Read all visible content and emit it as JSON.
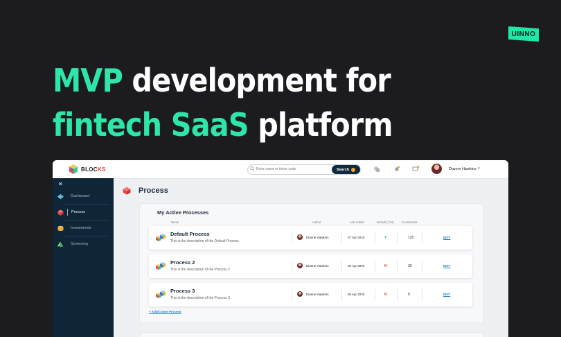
{
  "brand_badge": "UINNO",
  "headline": {
    "line1_accent": "MVP",
    "line1_rest": " development for",
    "line2_accent": "fintech SaaS",
    "line2_rest": " platform"
  },
  "app": {
    "logo_text_a": "BLOC",
    "logo_text_b": "KS",
    "search_placeholder": "Enter name or ticker code",
    "search_button": "Search",
    "user_name": "Dianne Hawkins",
    "sidebar": [
      {
        "label": "Dashboard",
        "icon": "dashboard-icon"
      },
      {
        "label": "Process",
        "icon": "process-cube-icon",
        "active": true
      },
      {
        "label": "Investments",
        "icon": "investments-coin-icon"
      },
      {
        "label": "Screening",
        "icon": "screening-pyramid-icon"
      }
    ],
    "page_title": "Process",
    "panel_title": "My Active Processes",
    "columns": {
      "name": "Name",
      "author": "Author",
      "last_edited": "Last edited",
      "default": "Default (Y/N)",
      "investments": "Investments"
    },
    "rows": [
      {
        "name": "Default Process",
        "description": "This is the description of the Default Process",
        "author": "Dianne Hawkins",
        "date": "07 Apr 2020",
        "default": "Y",
        "investments": "125",
        "edit": "EDIT"
      },
      {
        "name": "Process 2",
        "description": "This is the description of the Process 2",
        "author": "Dianne Hawkins",
        "date": "08 Apr 2020",
        "default": "N",
        "investments": "30",
        "edit": "EDIT"
      },
      {
        "name": "Process 3",
        "description": "This is the description of the Process 3",
        "author": "Dianne Hawkins",
        "date": "08 Apr 2020",
        "default": "N",
        "investments": "0",
        "edit": "EDIT"
      }
    ],
    "add_link": "+ Add/Create Process"
  },
  "colors": {
    "accent_green": "#2ee6a8",
    "default_yes": "#1aa36f",
    "default_no": "#e04040",
    "link_blue": "#1e7ec8"
  }
}
